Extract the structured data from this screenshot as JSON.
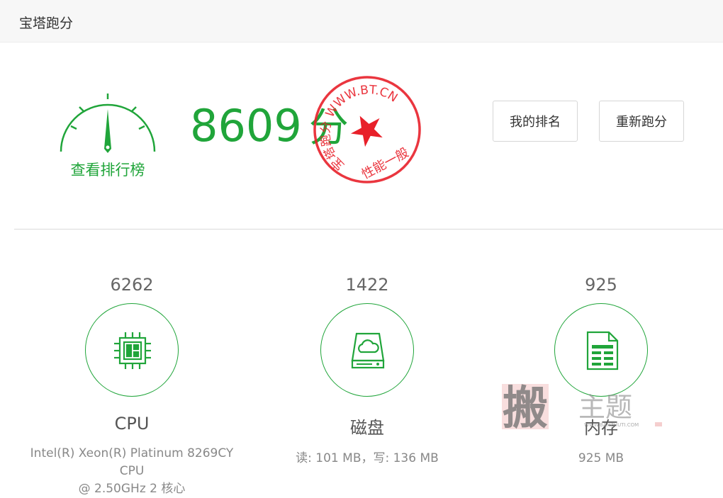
{
  "header": {
    "title": "宝塔跑分"
  },
  "score": {
    "value": "8609",
    "unit": "分"
  },
  "gauge": {
    "label": "查看排行榜"
  },
  "stamp": {
    "url_text": "WWW.BT.CN",
    "left_text": "宝塔跑分",
    "bottom_text": "性能一般"
  },
  "buttons": {
    "my_rank": "我的排名",
    "rerun": "重新跑分"
  },
  "metrics": {
    "cpu": {
      "score": "6262",
      "name": "CPU",
      "desc_line1": "Intel(R) Xeon(R) Platinum 8269CY CPU",
      "desc_line2": "@ 2.50GHz 2 核心"
    },
    "disk": {
      "score": "1422",
      "name": "磁盘",
      "desc": "读: 101 MB，写: 136 MB"
    },
    "memory": {
      "score": "925",
      "name": "内存",
      "desc": "925 MB"
    }
  },
  "watermark": {
    "big_char": "搬",
    "side_text": "主题",
    "site": "WWW.BANZHUTI.COM"
  },
  "colors": {
    "accent": "#20a53a",
    "stamp": "#e8202a"
  },
  "icons": {
    "gauge": "speedometer-icon",
    "cpu": "cpu-chip-icon",
    "disk": "cloud-disk-icon",
    "memory": "document-icon"
  }
}
